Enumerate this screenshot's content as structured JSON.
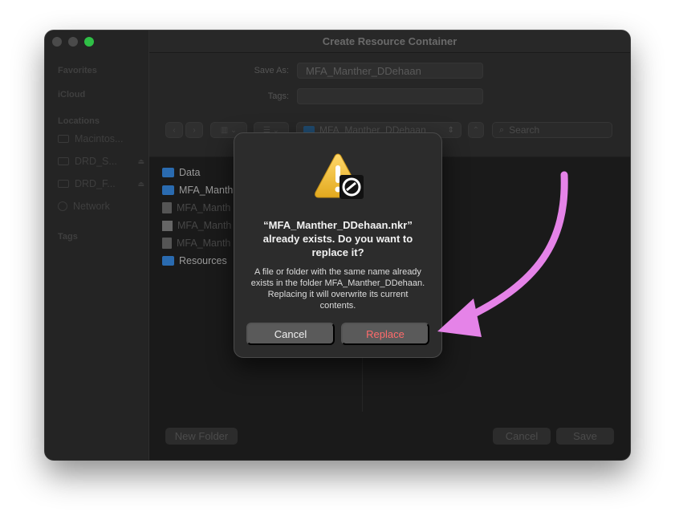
{
  "window": {
    "title": "Create Resource Container"
  },
  "sidebar": {
    "favorites_header": "Favorites",
    "icloud_header": "iCloud",
    "locations_header": "Locations",
    "locations": [
      {
        "label": "Macintos...",
        "eject": false
      },
      {
        "label": "DRD_S...",
        "eject": true
      },
      {
        "label": "DRD_F...",
        "eject": true
      },
      {
        "label": "Network",
        "eject": false
      }
    ],
    "tags_header": "Tags"
  },
  "form": {
    "save_as_label": "Save As:",
    "save_as_value": "MFA_Manther_DDehaan",
    "tags_label": "Tags:",
    "tags_value": ""
  },
  "toolbar": {
    "location": "MFA_Manther_DDehaan",
    "search_placeholder": "Search"
  },
  "file_list": [
    {
      "name": "Data",
      "kind": "folder",
      "dim": false
    },
    {
      "name": "MFA_Manth",
      "kind": "folder",
      "dim": false
    },
    {
      "name": "MFA_Manth",
      "kind": "doc",
      "dim": true
    },
    {
      "name": "MFA_Manth",
      "kind": "piano",
      "dim": true
    },
    {
      "name": "MFA_Manth",
      "kind": "doc",
      "dim": true
    },
    {
      "name": "Resources",
      "kind": "folder",
      "dim": false
    }
  ],
  "bottom": {
    "new_folder": "New Folder",
    "cancel": "Cancel",
    "save": "Save"
  },
  "dialog": {
    "title": "“MFA_Manther_DDehaan.nkr” already exists. Do you want to replace it?",
    "message": "A file or folder with the same name already exists in the folder MFA_Manther_DDehaan. Replacing it will overwrite its current contents.",
    "cancel_label": "Cancel",
    "replace_label": "Replace",
    "icon": "warning-icon"
  },
  "colors": {
    "arrow": "#e583e8",
    "replace_text": "#ff6b6b",
    "accent_green": "#2fbf46"
  }
}
